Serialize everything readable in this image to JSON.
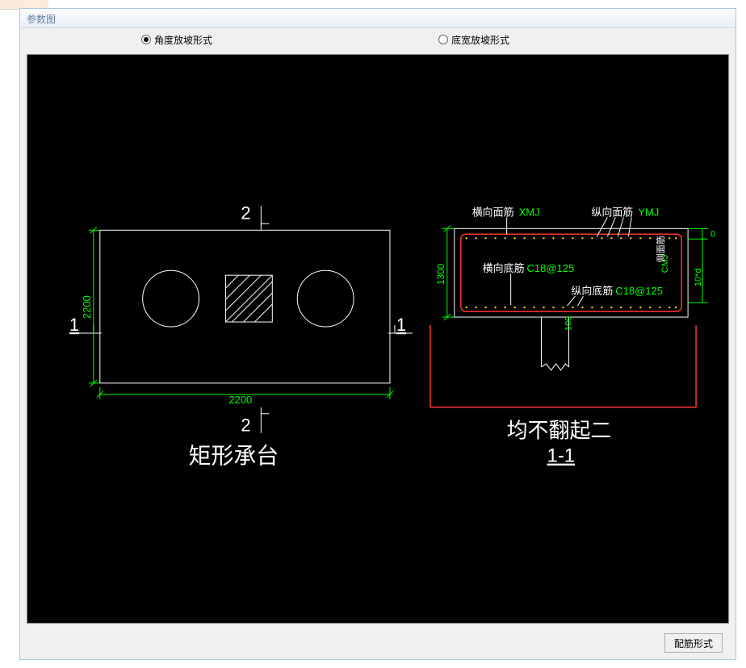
{
  "dialog": {
    "title": "参数图"
  },
  "radios": {
    "angle": "角度放坡形式",
    "width": "底宽放坡形式"
  },
  "buttons": {
    "rebar_form": "配筋形式"
  },
  "drawing": {
    "left": {
      "title": "矩形承台",
      "section_mark_top": "2",
      "section_mark_bottom": "2",
      "section_mark_left": "1",
      "section_mark_right": "1",
      "dim_width": "2200",
      "dim_height": "2200"
    },
    "right": {
      "title_1": "均不翻起二",
      "title_2": "1-1",
      "label_hxmj": "横向面筋",
      "code_xmj": "XMJ",
      "label_zxmj": "纵向面筋",
      "code_ymj": "YMJ",
      "label_hxdj": "横向底筋",
      "code_hxdj": "C18@125",
      "label_zxdj": "纵向底筋",
      "code_zxdj": "C18@125",
      "label_cmj": "CMJ",
      "label_cmj_text": "侧面筋",
      "dim_height": "1300",
      "dim_d0": "0",
      "dim_10d": "10*d",
      "dim_100": "100"
    }
  }
}
